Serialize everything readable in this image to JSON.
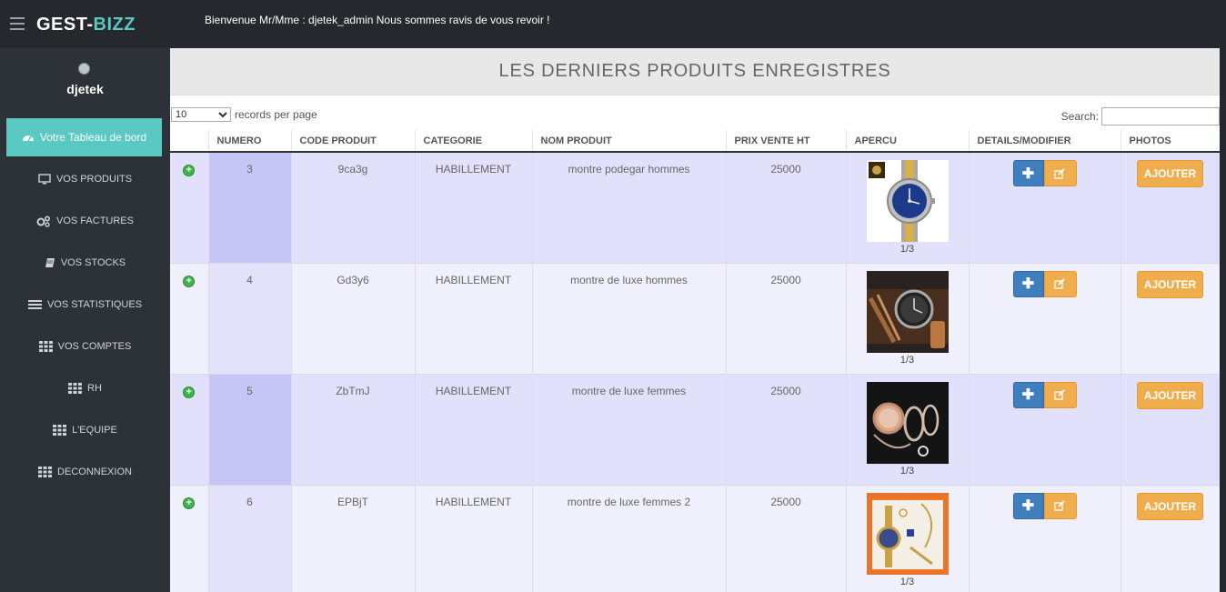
{
  "app": {
    "logo_part1": "GEST-",
    "logo_part2": "BIZZ",
    "welcome": "Bienvenue Mr/Mme : djetek_admin Nous sommes ravis de vous revoir !"
  },
  "sidebar": {
    "username": "djetek",
    "dashboard_label": "Votre Tableau de bord",
    "items": [
      {
        "label": "VOS PRODUITS",
        "icon": "monitor-icon"
      },
      {
        "label": "VOS FACTURES",
        "icon": "gears-icon"
      },
      {
        "label": "VOS STOCKS",
        "icon": "book-icon"
      },
      {
        "label": "VOS STATISTIQUES",
        "icon": "list-icon"
      },
      {
        "label": "VOS COMPTES",
        "icon": "grid-icon"
      },
      {
        "label": "RH",
        "icon": "grid-icon"
      },
      {
        "label": "L'EQUIPE",
        "icon": "grid-icon"
      },
      {
        "label": "DECONNEXION",
        "icon": "grid-icon"
      }
    ]
  },
  "page": {
    "title": "LES DERNIERS PRODUITS ENREGISTRES",
    "records_value": "10",
    "records_label": "records per page",
    "search_label": "Search:"
  },
  "table": {
    "headers": [
      "NUMERO",
      "CODE PRODUIT",
      "CATEGORIE",
      "NOM PRODUIT",
      "PRIX VENTE HT",
      "APERCU",
      "DETAILS/MODIFIER",
      "PHOTOS"
    ],
    "rows": [
      {
        "numero": "3",
        "code": "9ca3g",
        "categorie": "HABILLEMENT",
        "nom": "montre podegar hommes",
        "prix": "25000",
        "counter": "1/3",
        "add_label": "AJOUTER"
      },
      {
        "numero": "4",
        "code": "Gd3y6",
        "categorie": "HABILLEMENT",
        "nom": "montre de luxe hommes",
        "prix": "25000",
        "counter": "1/3",
        "add_label": "AJOUTER"
      },
      {
        "numero": "5",
        "code": "ZbTmJ",
        "categorie": "HABILLEMENT",
        "nom": "montre de luxe femmes",
        "prix": "25000",
        "counter": "1/3",
        "add_label": "AJOUTER"
      },
      {
        "numero": "6",
        "code": "EPBjT",
        "categorie": "HABILLEMENT",
        "nom": "montre de luxe femmes 2",
        "prix": "25000",
        "counter": "1/3",
        "add_label": "AJOUTER"
      }
    ]
  },
  "colors": {
    "topbar": "#25282c",
    "sidebar": "#2d3238",
    "accent": "#5ac8c3",
    "primary_button": "#3f7fbd",
    "warning_button": "#f0ad4e"
  }
}
